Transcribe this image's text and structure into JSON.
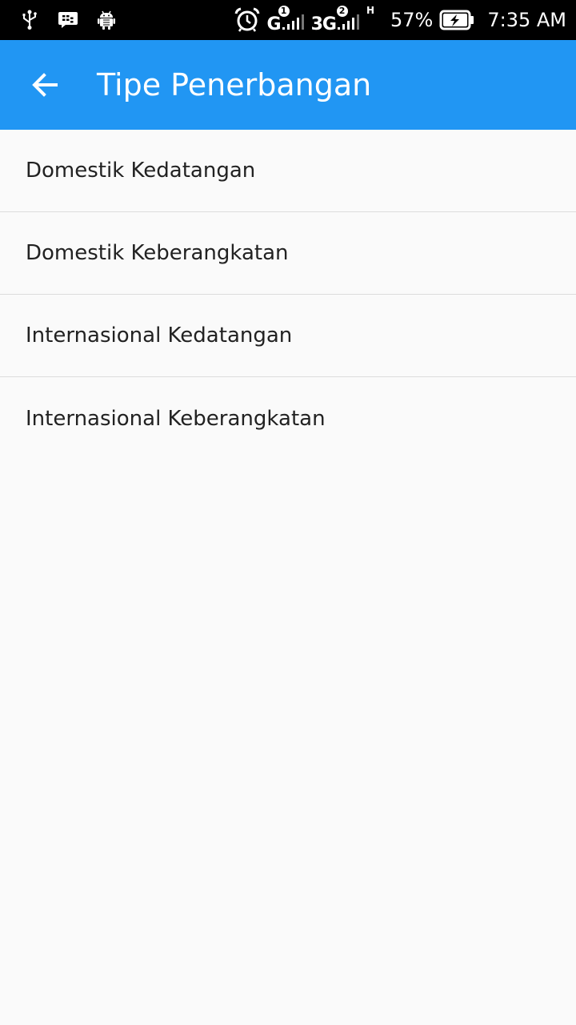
{
  "status_bar": {
    "sim1_network": "G",
    "sim1_slot": "1",
    "sim2_network": "3G",
    "sim2_slot": "2",
    "data_type": "H",
    "battery_percent": "57%",
    "time": "7:35 AM",
    "icons": [
      "usb-icon",
      "bbm-icon",
      "android-debug-icon",
      "alarm-icon",
      "signal-icon",
      "battery-charging-icon"
    ]
  },
  "app_bar": {
    "title": "Tipe Penerbangan",
    "back_icon": "arrow-left-icon",
    "background_color": "#2196f3"
  },
  "list": {
    "items": [
      {
        "label": "Domestik Kedatangan"
      },
      {
        "label": "Domestik Keberangkatan"
      },
      {
        "label": "Internasional Kedatangan"
      },
      {
        "label": "Internasional Keberangkatan"
      }
    ]
  }
}
